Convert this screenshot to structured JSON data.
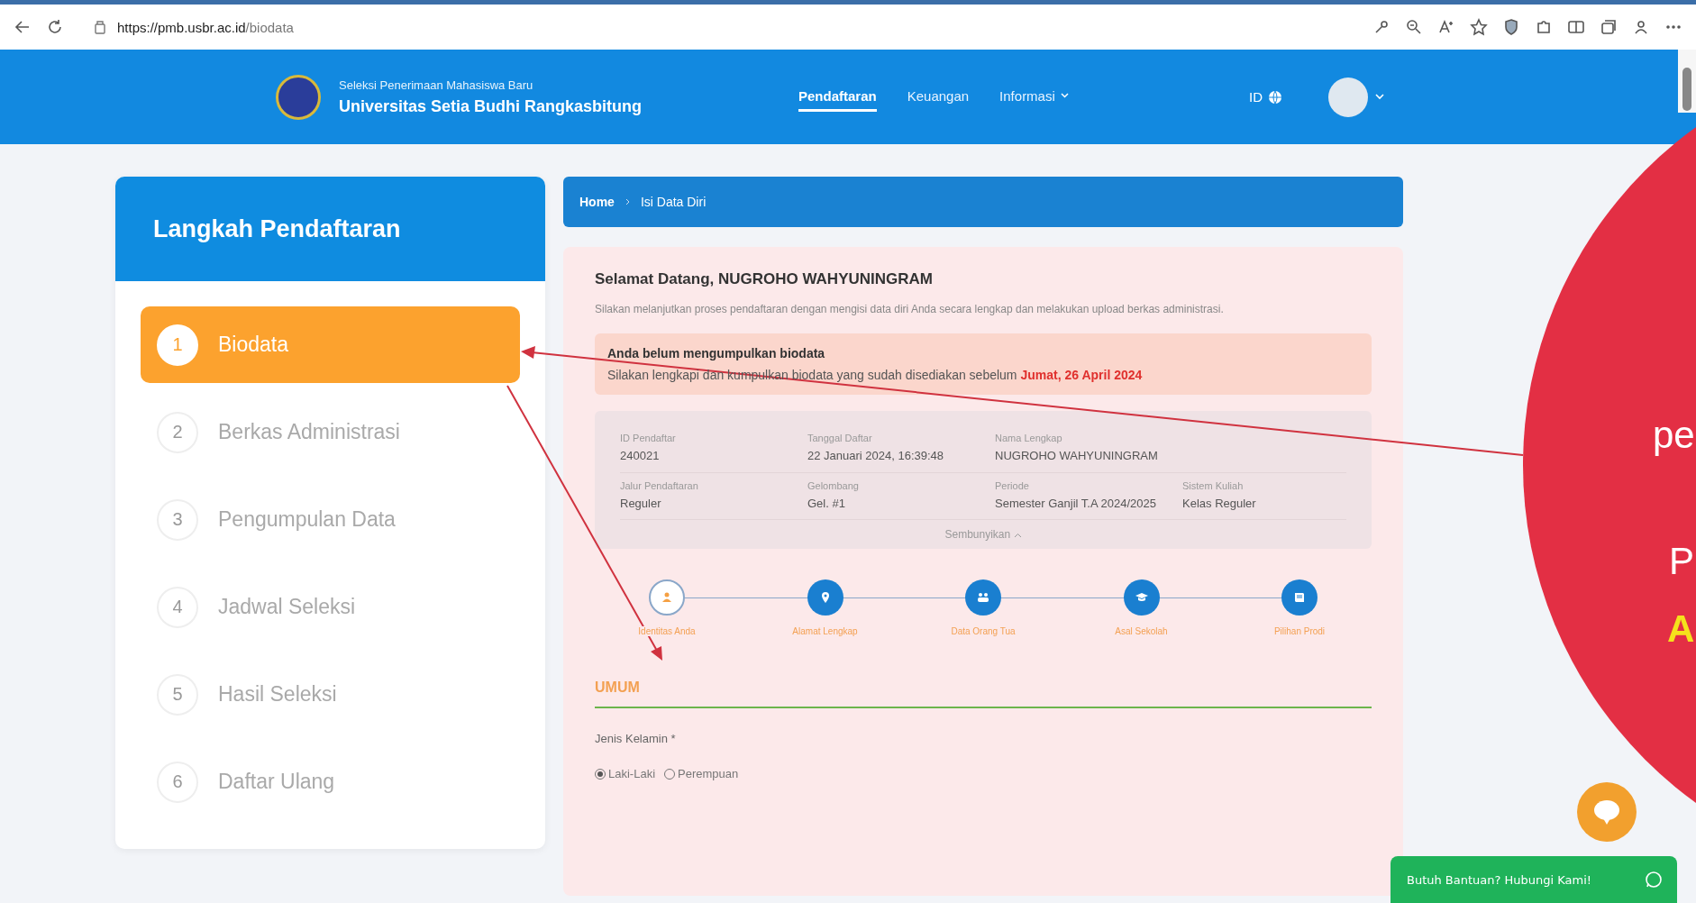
{
  "browser": {
    "url_host": "https://pmb.usbr.ac.id",
    "url_path": "/biodata"
  },
  "header": {
    "subtitle": "Seleksi Penerimaan Mahasiswa Baru",
    "title": "Universitas Setia Budhi Rangkasbitung",
    "nav": [
      {
        "label": "Pendaftaran",
        "selected": true,
        "dropdown": false
      },
      {
        "label": "Keuangan",
        "selected": false,
        "dropdown": false
      },
      {
        "label": "Informasi",
        "selected": false,
        "dropdown": true
      }
    ],
    "language": "ID"
  },
  "sidebar": {
    "title": "Langkah Pendaftaran",
    "steps": [
      {
        "number": "1",
        "label": "Biodata",
        "selected": true
      },
      {
        "number": "2",
        "label": "Berkas Administrasi",
        "selected": false
      },
      {
        "number": "3",
        "label": "Pengumpulan Data",
        "selected": false
      },
      {
        "number": "4",
        "label": "Jadwal Seleksi",
        "selected": false
      },
      {
        "number": "5",
        "label": "Hasil Seleksi",
        "selected": false
      },
      {
        "number": "6",
        "label": "Daftar Ulang",
        "selected": false
      }
    ]
  },
  "breadcrumb": [
    "Home",
    "Isi Data Diri"
  ],
  "welcome": {
    "title": "Selamat Datang, NUGROHO WAHYUNINGRAM",
    "text": "Silakan melanjutkan proses pendaftaran dengan mengisi data diri Anda secara lengkap dan melakukan upload berkas administrasi."
  },
  "alert": {
    "title": "Anda belum mengumpulkan biodata",
    "text": "Silakan lengkapi dan kumpulkan biodata yang sudah disediakan sebelum **Jumat, 26 April 2024**"
  },
  "info": {
    "rows": [
      [
        {
          "label": "ID Pendaftar",
          "value": "240021"
        },
        {
          "label": "Tanggal Daftar",
          "value": "22 Januari 2024, 16:39:48"
        },
        {
          "label": "Nama Lengkap",
          "value": "NUGROHO WAHYUNINGRAM"
        }
      ],
      [
        {
          "label": "Jalur Pendaftaran",
          "value": "Reguler"
        },
        {
          "label": "Gelombang",
          "value": "Gel. #1"
        },
        {
          "label": "Periode",
          "value": "Semester Ganjil T.A 2024/2025"
        },
        {
          "label": "Sistem Kuliah",
          "value": "Kelas Reguler"
        }
      ]
    ],
    "toggle": "Sembunyikan"
  },
  "progress": [
    {
      "kind": "person",
      "label": "Identitas Anda",
      "selected": true
    },
    {
      "kind": "pin",
      "label": "Alamat Lengkap",
      "selected": false
    },
    {
      "kind": "people",
      "label": "Data Orang Tua",
      "selected": false
    },
    {
      "kind": "cap",
      "label": "Asal Sekolah",
      "selected": false
    },
    {
      "kind": "book",
      "label": "Pilihan Prodi",
      "selected": false
    }
  ],
  "section": "UMUM",
  "gender": {
    "label": "Jenis Kelamin *",
    "options": [
      {
        "label": "Laki-Laki",
        "checked": true
      },
      {
        "label": "Perempuan",
        "checked": false
      }
    ]
  },
  "overlay": {
    "texts": [
      {
        "text": "pe",
        "kind": "white"
      },
      {
        "text": "P",
        "kind": "white"
      },
      {
        "text": "A",
        "kind": "yellow"
      }
    ]
  },
  "help_button": "Butuh Bantuan? Hubungi Kami!"
}
